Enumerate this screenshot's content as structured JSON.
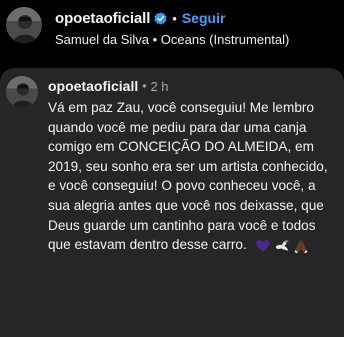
{
  "header": {
    "username": "opoetaoficiall",
    "separator": "•",
    "follow_label": "Seguir",
    "music_artist": "Samuel da Silva",
    "music_separator": "•",
    "music_track": "Oceans (Instrumental)"
  },
  "comment": {
    "username": "opoetaoficiall",
    "separator": "•",
    "time": "2 h",
    "text": "Vá em paz Zau, você conseguiu! Me lembro quando você me pediu para dar uma canja comigo em CONCEIÇÃO DO ALMEIDA, em 2019, seu sonho era ser um artista conhecido, e você conseguiu! O povo conheceu você, a sua alegria antes que você nos deixasse, que Deus guarde um cantinho para você e todos que estavam dentro desse carro.",
    "emojis": [
      "purple-heart",
      "dove",
      "praying-hands"
    ]
  },
  "colors": {
    "background": "#000000",
    "card_background": "#262626",
    "follow_blue": "#4a9bf5",
    "verified_blue": "#3897f0",
    "muted_text": "#a8a8a8"
  }
}
